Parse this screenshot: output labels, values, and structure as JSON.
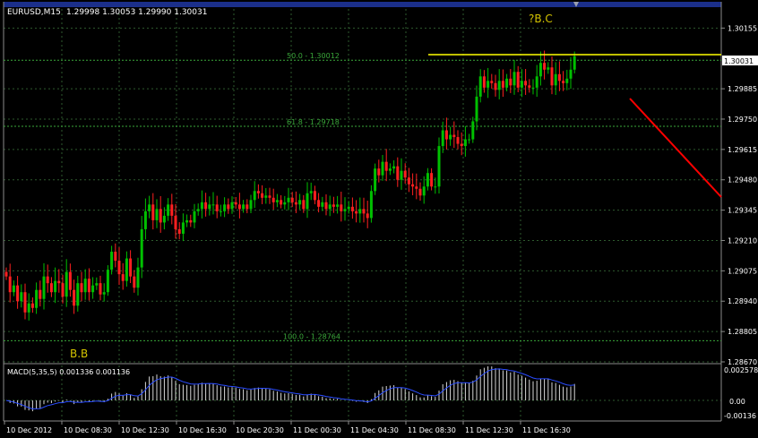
{
  "header": {
    "symbol": "EURUSD,M15",
    "ohlc": "1.29998 1.30053 1.29990 1.30031"
  },
  "annotations": {
    "wave_top": "?B.C",
    "wave_bottom": "B.B"
  },
  "fib_levels": [
    {
      "label": "50.0 - 1.30012",
      "price": 1.30012
    },
    {
      "label": "61.8 - 1.29718",
      "price": 1.29718
    },
    {
      "label": "100.0 - 1.28764",
      "price": 1.28764
    }
  ],
  "current_price": "1.30031",
  "macd": {
    "label": "MACD(5,35,5) 0.001336 0.001136",
    "scale_labels": [
      "0.002578",
      "0.00",
      "-0.00136"
    ]
  },
  "colors": {
    "bull": "#00c000",
    "bear": "#ff2020",
    "grid": "#2e5a2e",
    "fib": "#3aa83a",
    "resistance": "#ffff00",
    "trendline": "#ff0000",
    "annotation": "#d4c400",
    "header_bar": "#1b2f8a",
    "signal": "#2a4cff"
  },
  "chart_data": {
    "type": "candlestick",
    "title": "EURUSD,M15",
    "ylim": [
      1.2867,
      1.3024
    ],
    "price_ticks": [
      "1.30155",
      "1.29885",
      "1.29750",
      "1.29615",
      "1.29480",
      "1.29345",
      "1.29210",
      "1.29075",
      "1.28940",
      "1.28805",
      "1.28670"
    ],
    "time_ticks": [
      "10 Dec 2012",
      "10 Dec 08:30",
      "10 Dec 12:30",
      "10 Dec 16:30",
      "10 Dec 20:30",
      "11 Dec 00:30",
      "11 Dec 04:30",
      "11 Dec 08:30",
      "11 Dec 12:30",
      "11 Dec 16:30"
    ],
    "series": [
      {
        "name": "EURUSD,M15",
        "values": [
          1.2905,
          1.2898,
          1.2901,
          1.2894,
          1.2898,
          1.2889,
          1.2893,
          1.2891,
          1.2899,
          1.2895,
          1.2905,
          1.2902,
          1.2898,
          1.2903,
          1.2902,
          1.2896,
          1.2907,
          1.2899,
          1.2892,
          1.2902,
          1.2898,
          1.2904,
          1.2898,
          1.2901,
          1.2902,
          1.2897,
          1.2898,
          1.2908,
          1.2916,
          1.2912,
          1.2906,
          1.2903,
          1.2913,
          1.2905,
          1.29,
          1.2909,
          1.2926,
          1.2934,
          1.2937,
          1.293,
          1.2935,
          1.2929,
          1.2932,
          1.2937,
          1.2932,
          1.2926,
          1.2924,
          1.2929,
          1.293,
          1.2929,
          1.2934,
          1.2935,
          1.2938,
          1.2935,
          1.2937,
          1.2937,
          1.2934,
          1.2934,
          1.2937,
          1.2935,
          1.2938,
          1.2937,
          1.2935,
          1.2937,
          1.2935,
          1.2939,
          1.2943,
          1.2942,
          1.294,
          1.2941,
          1.294,
          1.2938,
          1.2939,
          1.2937,
          1.2938,
          1.294,
          1.2938,
          1.2937,
          1.2939,
          1.2935,
          1.2942,
          1.2943,
          1.2939,
          1.2936,
          1.2938,
          1.2935,
          1.2937,
          1.2936,
          1.2937,
          1.2934,
          1.2935,
          1.2936,
          1.2934,
          1.2933,
          1.2935,
          1.2933,
          1.2931,
          1.2943,
          1.2953,
          1.295,
          1.2956,
          1.2952,
          1.2953,
          1.2954,
          1.2948,
          1.2952,
          1.2949,
          1.2946,
          1.2945,
          1.2944,
          1.2941,
          1.2945,
          1.2951,
          1.2945,
          1.2945,
          1.2963,
          1.297,
          1.2966,
          1.2968,
          1.2967,
          1.2964,
          1.2963,
          1.2966,
          1.2966,
          1.2974,
          1.2985,
          1.2994,
          1.2989,
          1.2992,
          1.2991,
          1.2988,
          1.2992,
          1.2989,
          1.2993,
          1.299,
          1.2996,
          1.2989,
          1.2992,
          1.299,
          1.2989,
          1.2989,
          1.2994,
          1.3,
          1.2997,
          1.2998,
          1.299,
          1.2995,
          1.2992,
          1.2991,
          1.2993,
          1.2997,
          1.3003
        ]
      }
    ],
    "xlabel": "",
    "ylabel": ""
  }
}
